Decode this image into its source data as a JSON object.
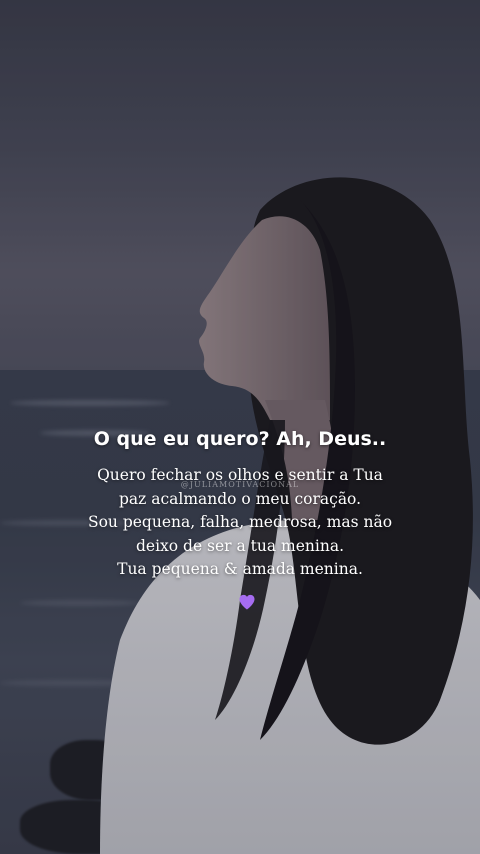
{
  "watermark": "@JULIAMOTIVACIONAL",
  "title": "O que eu quero? Ah, Deus..",
  "poem_lines": [
    "Quero fechar os olhos e sentir a Tua",
    "paz acalmando o meu coração.",
    "Sou pequena, falha, medrosa, mas não",
    "deixo de ser a tua menina.",
    "Tua pequena & amada menina."
  ],
  "heart_icon": "purple-heart-icon",
  "colors": {
    "text": "#ffffff",
    "heart": "#a56cf0"
  }
}
